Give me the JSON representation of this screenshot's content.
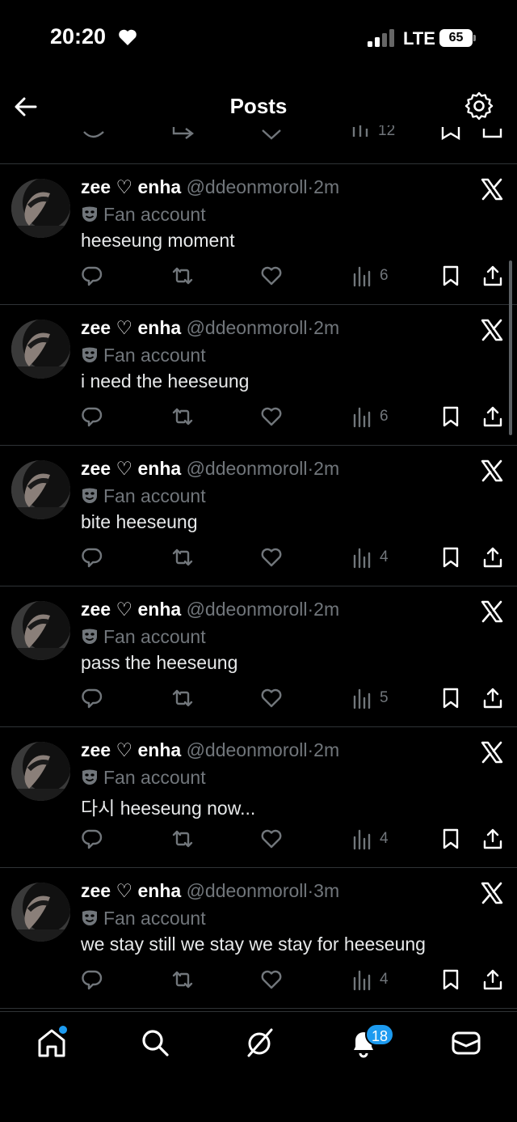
{
  "status_bar": {
    "time": "20:20",
    "network": "LTE",
    "battery": "65"
  },
  "header": {
    "title": "Posts"
  },
  "posts": [
    {
      "name": "zee ♡ enha",
      "handle": "@ddeonmoroll",
      "time": "2m",
      "badge": "Fan account",
      "text": "heeseung moment",
      "views": "6"
    },
    {
      "name": "zee ♡ enha",
      "handle": "@ddeonmoroll",
      "time": "2m",
      "badge": "Fan account",
      "text": "i need the heeseung",
      "views": "6"
    },
    {
      "name": "zee ♡ enha",
      "handle": "@ddeonmoroll",
      "time": "2m",
      "badge": "Fan account",
      "text": "bite heeseung",
      "views": "4"
    },
    {
      "name": "zee ♡ enha",
      "handle": "@ddeonmoroll",
      "time": "2m",
      "badge": "Fan account",
      "text": "pass the heeseung",
      "views": "5"
    },
    {
      "name": "zee ♡ enha",
      "handle": "@ddeonmoroll",
      "time": "2m",
      "badge": "Fan account",
      "text": "다시 heeseung now...",
      "views": "4"
    },
    {
      "name": "zee ♡ enha",
      "handle": "@ddeonmoroll",
      "time": "3m",
      "badge": "Fan account",
      "text": "we stay still we stay we stay for heeseung",
      "views": "4"
    }
  ],
  "partial_post": {
    "views": "12"
  },
  "bottom_nav": {
    "notifications_count": "18"
  },
  "colors": {
    "accent": "#1d9bf0",
    "muted": "#71767b",
    "divider": "#2f3336",
    "background": "#000000"
  },
  "icons": {
    "back": "arrow-left-icon",
    "settings": "gear-icon",
    "x_logo": "x-logo-icon",
    "reply": "reply-icon",
    "repost": "repost-icon",
    "like": "heart-icon",
    "views": "views-icon",
    "bookmark": "bookmark-icon",
    "share": "share-icon",
    "badge": "theater-mask-icon"
  }
}
